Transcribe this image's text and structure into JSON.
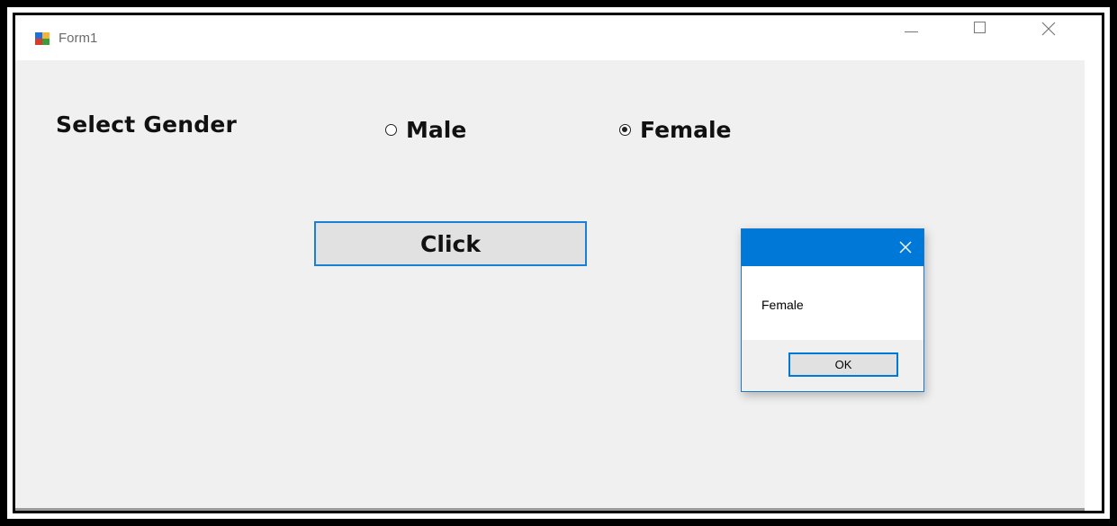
{
  "window": {
    "title": "Form1",
    "icon": "winforms-app-icon"
  },
  "form": {
    "select_label": "Select Gender",
    "radios": [
      {
        "label": "Male",
        "checked": false
      },
      {
        "label": "Female",
        "checked": true
      }
    ],
    "button_label": "Click"
  },
  "message_box": {
    "title": "",
    "text": "Female",
    "ok_label": "OK",
    "accent_color": "#0078d7"
  },
  "colors": {
    "client_background": "#f0f0f0",
    "button_border": "#1a7fd6",
    "titlebar_background": "#ffffff"
  }
}
